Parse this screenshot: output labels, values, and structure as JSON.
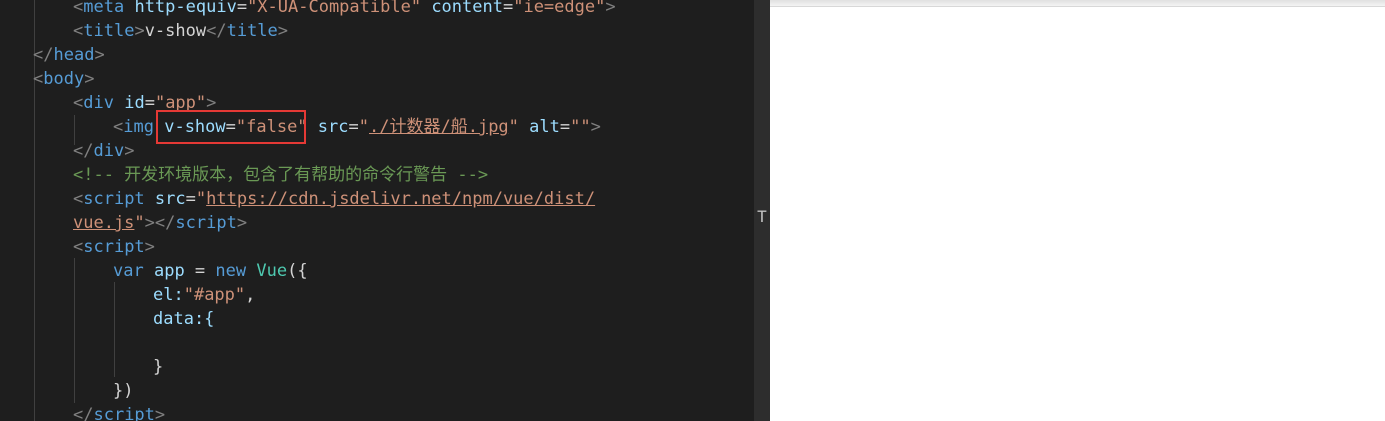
{
  "editor": {
    "l1": {
      "open": "<",
      "tag": "meta",
      "a1": "http-equiv",
      "eq1": "=",
      "v1": "\"X-UA-Compatible\"",
      "a2": "content",
      "eq2": "=",
      "v2": "\"ie=edge\"",
      "close": ">"
    },
    "l2": {
      "o1": "<",
      "tag": "title",
      "c1": ">",
      "text": "v-show",
      "o2": "</",
      "tag2": "title",
      "c2": ">"
    },
    "l3": {
      "o": "</",
      "tag": "head",
      "c": ">"
    },
    "l4": {
      "o": "<",
      "tag": "body",
      "c": ">"
    },
    "l5": {
      "o": "<",
      "tag": "div",
      "attr": "id",
      "eq": "=",
      "val": "\"app\"",
      "c": ">"
    },
    "l6": {
      "o": "<",
      "tag": "img",
      "a1": "v-show",
      "eq1": "=",
      "v1": "\"false\"",
      "a2": "src",
      "eq2": "=",
      "q1": "\"",
      "v2": "./计数器/船.jpg",
      "q2": "\"",
      "a3": "alt",
      "eq3": "=",
      "v3": "\"\"",
      "c": ">"
    },
    "l7": {
      "o": "</",
      "tag": "div",
      "c": ">"
    },
    "l8": {
      "text": "<!-- 开发环境版本，包含了有帮助的命令行警告 -->"
    },
    "l9": {
      "o": "<",
      "tag": "script",
      "attr": "src",
      "eq": "=",
      "q": "\"",
      "url": "https://cdn.jsdelivr.net/npm/vue/dist/"
    },
    "l10": {
      "url": "vue.js",
      "q": "\"",
      "c1": ">",
      "o2": "</",
      "tag": "script",
      "c2": ">"
    },
    "l11": {
      "o": "<",
      "tag": "script",
      "c": ">"
    },
    "l12": {
      "kw1": "var",
      "name": "app",
      "op": " = ",
      "kw2": "new",
      "cls": "Vue",
      "rest": "({"
    },
    "l13": {
      "key": "el:",
      "val": "\"#app\"",
      "comma": ","
    },
    "l14": {
      "key": "data:{"
    },
    "l16": {
      "text": "}"
    },
    "l17": {
      "text": "})"
    },
    "l18": {
      "o": "</",
      "tag": "script",
      "c": ">"
    }
  },
  "scrollbar": {
    "mark": "T"
  }
}
